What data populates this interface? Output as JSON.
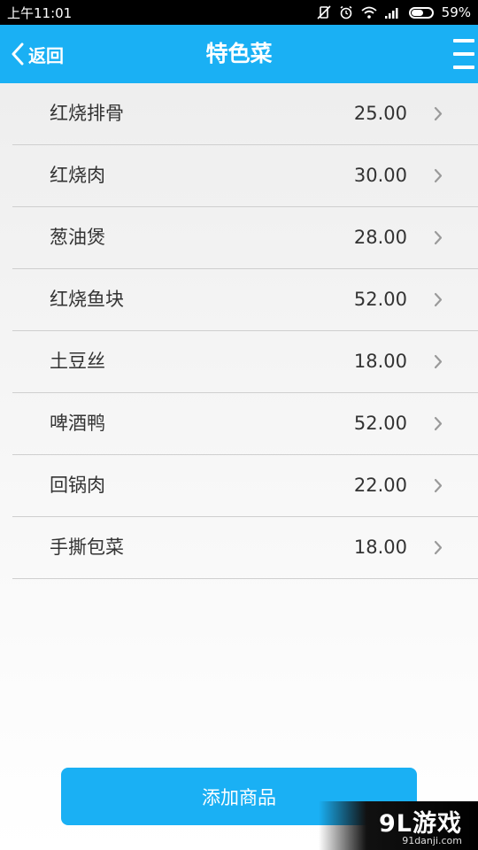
{
  "status_bar": {
    "time": "上午11:01",
    "battery_text": "59%",
    "battery_level": 0.59
  },
  "header": {
    "back_label": "返回",
    "title": "特色菜",
    "menu_icon": "hamburger-menu-icon",
    "accent_color": "#1ab0f4"
  },
  "items": [
    {
      "name": "红烧排骨",
      "price": "25.00"
    },
    {
      "name": "红烧肉",
      "price": "30.00"
    },
    {
      "name": "葱油煲",
      "price": "28.00"
    },
    {
      "name": "红烧鱼块",
      "price": "52.00"
    },
    {
      "name": "土豆丝",
      "price": "18.00"
    },
    {
      "name": "啤酒鸭",
      "price": "52.00"
    },
    {
      "name": "回锅肉",
      "price": "22.00"
    },
    {
      "name": "手撕包菜",
      "price": "18.00"
    }
  ],
  "add_button_label": "添加商品",
  "watermark": {
    "logo": "9L游戏",
    "site": "91danji.com"
  }
}
